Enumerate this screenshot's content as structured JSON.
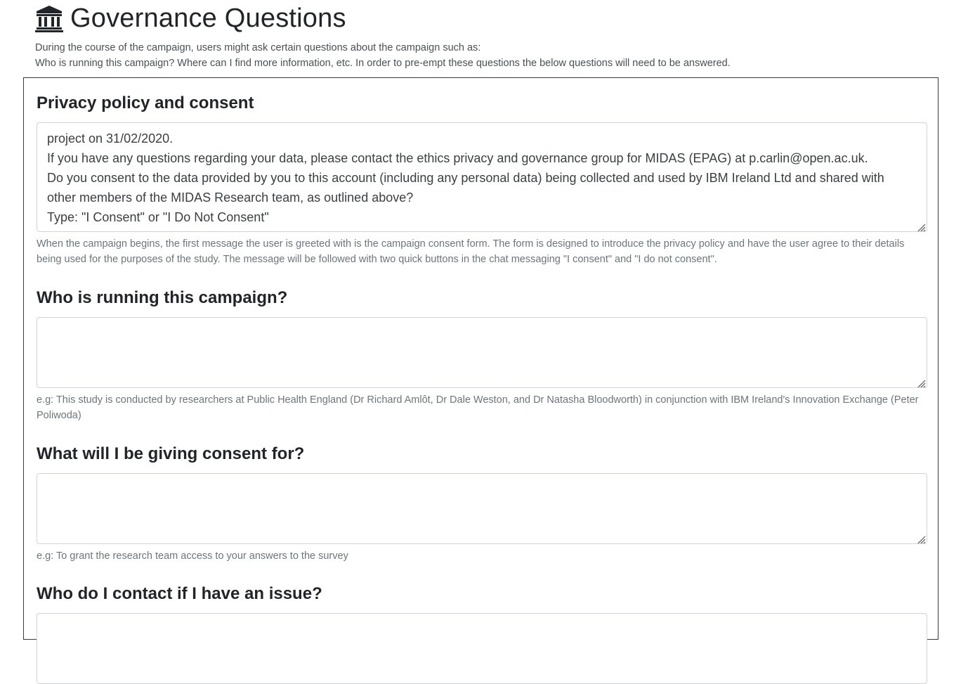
{
  "header": {
    "icon": "bank-icon",
    "title": "Governance Questions",
    "intro_line1": "During the course of the campaign, users might ask certain questions about the campaign such as:",
    "intro_line2": "Who is running this campaign? Where can I find more information, etc. In order to pre-empt these questions the below questions will need to be answered."
  },
  "sections": [
    {
      "title": "Privacy policy and consent",
      "value_lines": [
        "project on 31/02/2020.",
        "If you have any questions regarding your data, please contact the ethics privacy and governance group for MIDAS (EPAG) at p.carlin@open.ac.uk.",
        "Do you consent to the data provided by you to this account (including any personal data) being collected and used by IBM Ireland Ltd and shared with",
        "other members of the MIDAS Research team, as outlined above?",
        "Type: \"I Consent\"  or  \"I Do Not Consent\""
      ],
      "help": "When the campaign begins, the first message the user is greeted with is the campaign consent form. The form is designed to introduce the privacy policy and have the user agree to their details being used for the purposes of the study. The message will be followed with two quick buttons in the chat messaging \"I consent\" and \"I do not consent\"."
    },
    {
      "title": "Who is running this campaign?",
      "value": "",
      "help": "e.g: This study is conducted by researchers at Public Health England (Dr Richard Amlôt, Dr Dale Weston, and Dr Natasha Bloodworth) in conjunction with IBM Ireland's Innovation Exchange (Peter Poliwoda)"
    },
    {
      "title": "What will I be giving consent for?",
      "value": "",
      "help": "e.g: To grant the research team access to your answers to the survey"
    },
    {
      "title": "Who do I contact if I have an issue?",
      "value": ""
    }
  ]
}
